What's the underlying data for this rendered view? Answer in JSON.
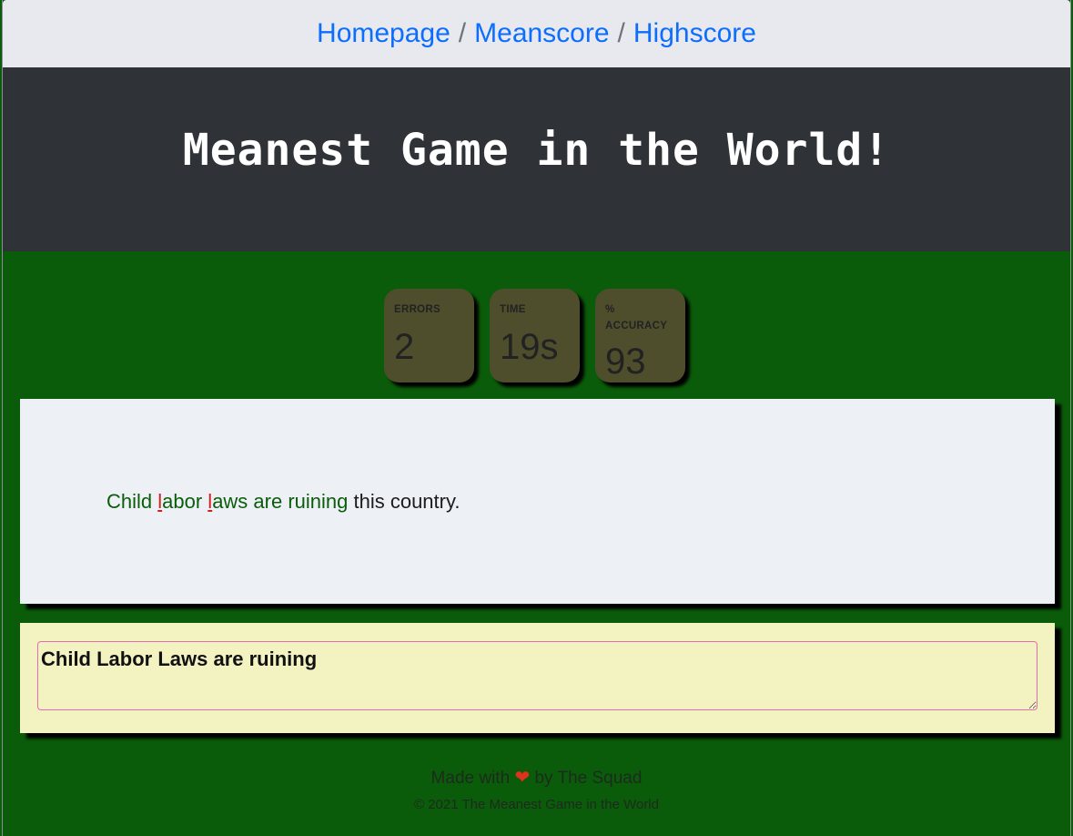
{
  "nav": {
    "items": [
      {
        "label": "Homepage"
      },
      {
        "label": "Meanscore"
      },
      {
        "label": "Highscore"
      }
    ],
    "separator": "/"
  },
  "header": {
    "title": "Meanest Game in the World!"
  },
  "stats": {
    "errors": {
      "label": "ERRORS",
      "value": "2"
    },
    "time": {
      "label": "TIME",
      "value": "19s"
    },
    "accuracy": {
      "label": "% ACCURACY",
      "value": "93"
    }
  },
  "prompt": {
    "segments": [
      {
        "text": "Child ",
        "state": "correct"
      },
      {
        "text": "l",
        "state": "error"
      },
      {
        "text": "abor ",
        "state": "correct"
      },
      {
        "text": "l",
        "state": "error"
      },
      {
        "text": "aws are ruining",
        "state": "correct"
      },
      {
        "text": " this country.",
        "state": "pending"
      }
    ]
  },
  "input": {
    "value": "Child Labor Laws are ruining"
  },
  "footer": {
    "made_prefix": "Made with",
    "heart_icon": "heart-icon",
    "made_suffix": "by The Squad",
    "copyright": "© 2021 The Meanest Game in the World"
  },
  "colors": {
    "page_bg": "#0a5c0a",
    "nav_bg": "#e7e9ee",
    "link": "#0d6efd",
    "header_bg": "#2f3337",
    "stat_bg": "#4e4e2d",
    "prompt_bg": "#edf1f5",
    "typed_correct": "#0b5c0b",
    "typed_error": "#d21f1f",
    "input_bg": "#f3f2c1",
    "input_border": "#e86ab0"
  }
}
